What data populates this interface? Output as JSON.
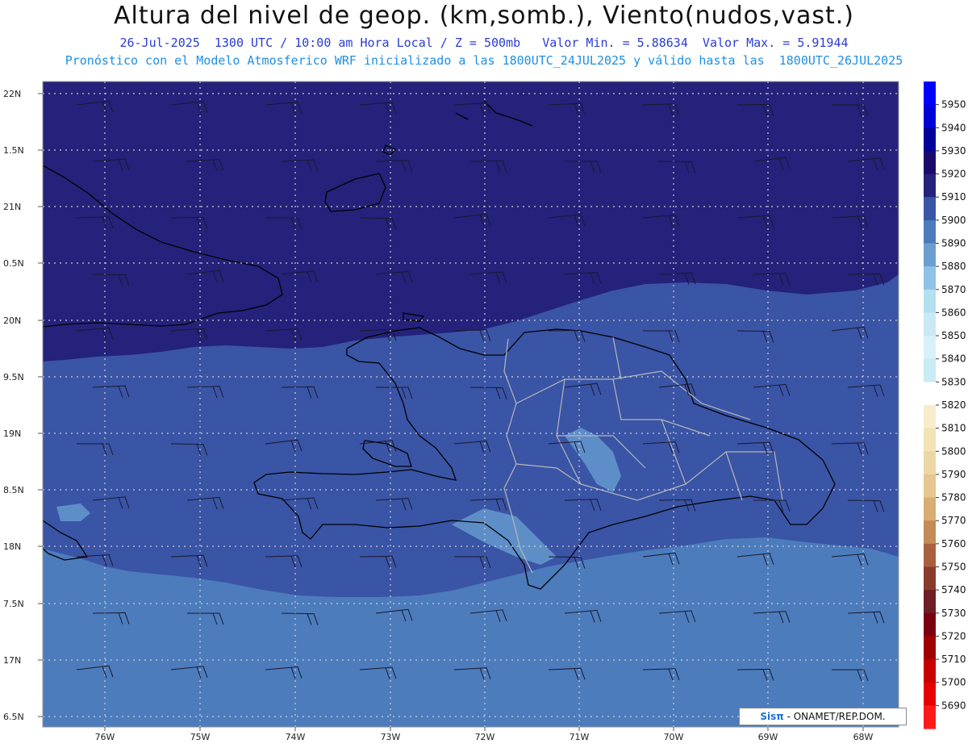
{
  "header": {
    "title": "Altura del nivel de geop. (km,somb.), Viento(nudos,vast.)",
    "subtitle_line1": "26-Jul-2025  1300 UTC / 10:00 am Hora Local / Z = 500mb   Valor Min. = 5.88634  Valor Max. = 5.91944",
    "subtitle_line2": "Pronóstico con el Modelo Atmosferico WRF inicializado a las 1800UTC_24JUL2025 y válido hasta las  1800UTC_26JUL2025"
  },
  "axes": {
    "lat_labels": [
      "22N",
      "1.5N",
      "21N",
      "0.5N",
      "20N",
      "9.5N",
      "19N",
      "8.5N",
      "18N",
      "7.5N",
      "17N",
      "6.5N"
    ],
    "lon_labels": [
      "76W",
      "75W",
      "74W",
      "73W",
      "72W",
      "71W",
      "70W",
      "69W",
      "68W"
    ]
  },
  "colorbar": {
    "labels": [
      "5950",
      "5940",
      "5930",
      "5920",
      "5910",
      "5900",
      "5890",
      "5880",
      "5870",
      "5860",
      "5850",
      "5840",
      "5830",
      "5820",
      "5810",
      "5800",
      "5790",
      "5780",
      "5770",
      "5760",
      "5750",
      "5740",
      "5730",
      "5720",
      "5710",
      "5700",
      "5690"
    ],
    "colors": [
      "#0000ff",
      "#0000d8",
      "#00009a",
      "#1a0a6e",
      "#24227a",
      "#3a54a6",
      "#4c7cbc",
      "#6a9fd0",
      "#8fc2e4",
      "#b4dff0",
      "#c9e9f4",
      "#d8f1f8",
      "#c7ecf4",
      "#ffffff",
      "#f8eccd",
      "#f2e2b6",
      "#ecd6a4",
      "#e5c690",
      "#d8ad74",
      "#c48a58",
      "#a9603e",
      "#8a3b2c",
      "#6e1e24",
      "#7a0011",
      "#a00000",
      "#c80000",
      "#e80000",
      "#ff1a1a"
    ]
  },
  "legend_colors": {
    "level_5920": "#24227a",
    "level_5910": "#3a54a6",
    "level_5900": "#4c7cbc",
    "level_5890": "#6a9fd0"
  },
  "credit": {
    "logo": "Sisπ",
    "text": " - ONAMET/REP.DOM."
  }
}
